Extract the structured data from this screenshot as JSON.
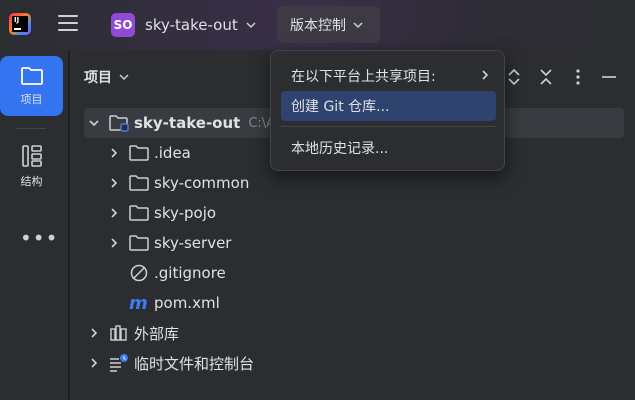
{
  "titlebar": {
    "project_badge": "SO",
    "project_name": "sky-take-out",
    "vcs_menu_label": "版本控制"
  },
  "toolstrip": {
    "items": [
      {
        "label": "项目",
        "icon": "folder-icon",
        "active": true
      },
      {
        "label": "结构",
        "icon": "structure-icon",
        "active": false
      }
    ],
    "more": "•••"
  },
  "panel": {
    "title": "项目",
    "tree": [
      {
        "label": "sky-take-out",
        "path": "C:\\A",
        "icon": "module-folder-icon",
        "expanded": true,
        "level": 0,
        "selected": true
      },
      {
        "label": ".idea",
        "icon": "folder-icon",
        "expanded": false,
        "level": 1
      },
      {
        "label": "sky-common",
        "icon": "folder-icon",
        "expanded": false,
        "level": 1
      },
      {
        "label": "sky-pojo",
        "icon": "folder-icon",
        "expanded": false,
        "level": 1
      },
      {
        "label": "sky-server",
        "icon": "folder-icon",
        "expanded": false,
        "level": 1
      },
      {
        "label": ".gitignore",
        "icon": "ignore-file-icon",
        "level": 1
      },
      {
        "label": "pom.xml",
        "icon": "maven-icon",
        "level": 1
      },
      {
        "label": "外部库",
        "icon": "library-icon",
        "expanded": false,
        "level": 0
      },
      {
        "label": "临时文件和控制台",
        "icon": "scratches-icon",
        "expanded": false,
        "level": 0
      }
    ]
  },
  "menu": {
    "items": [
      {
        "label": "在以下平台上共享项目:",
        "has_submenu": true,
        "highlighted": false
      },
      {
        "label": "创建 Git 仓库...",
        "has_submenu": false,
        "highlighted": true
      },
      {
        "label": "本地历史记录...",
        "has_submenu": false,
        "highlighted": false
      }
    ]
  },
  "colors": {
    "accent": "#3574f0",
    "badge": "#8f4ad6",
    "menu_highlight": "#2e436e",
    "maven": "#3d7cf0"
  }
}
